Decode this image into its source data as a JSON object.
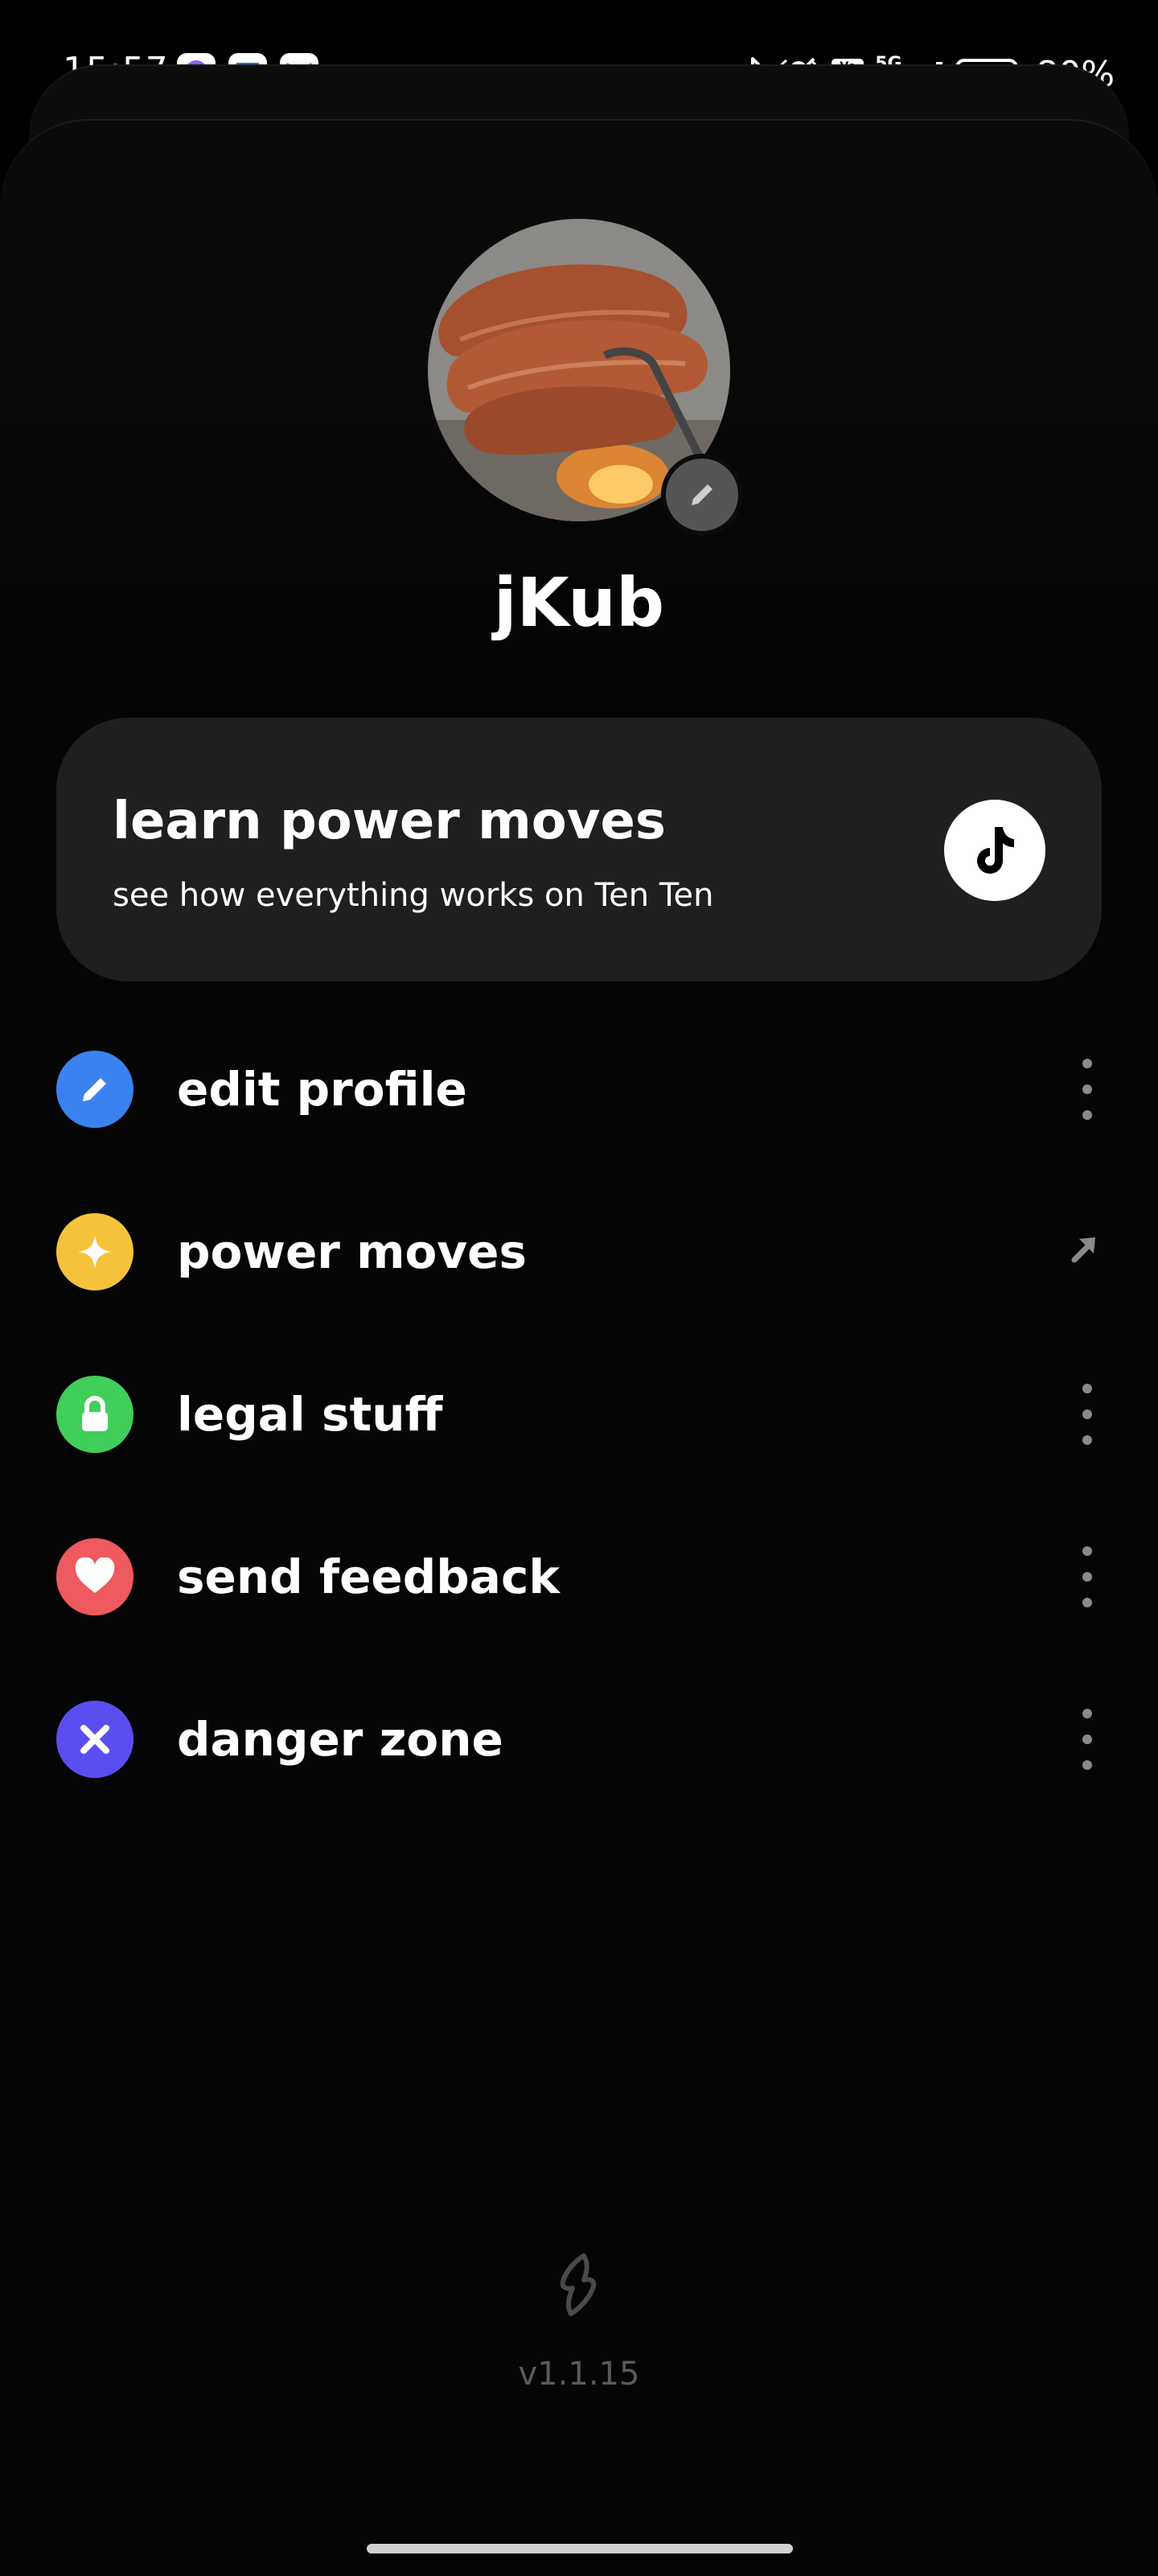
{
  "status_bar": {
    "time": "15:57",
    "battery": "80%",
    "more": "···",
    "network": "5G",
    "volte": "Vo LTE",
    "notification_icons": [
      "messenger-icon",
      "chat-icon",
      "gmail-icon"
    ]
  },
  "profile": {
    "username": "jKub"
  },
  "promo_card": {
    "title": "learn power moves",
    "subtitle": "see how everything works on Ten Ten"
  },
  "menu": {
    "items": [
      {
        "label": "edit profile",
        "icon": "pencil-icon",
        "color": "#3b82f0",
        "trailing": "more"
      },
      {
        "label": "power moves",
        "icon": "sparkle-icon",
        "color": "#f5c33b",
        "trailing": "external"
      },
      {
        "label": "legal stuff",
        "icon": "lock-icon",
        "color": "#3fcf5a",
        "trailing": "more"
      },
      {
        "label": "send feedback",
        "icon": "heart-icon",
        "color": "#ee5a5e",
        "trailing": "more"
      },
      {
        "label": "danger zone",
        "icon": "x-icon",
        "color": "#5b4ef0",
        "trailing": "more"
      }
    ]
  },
  "footer": {
    "version": "v1.1.15"
  }
}
